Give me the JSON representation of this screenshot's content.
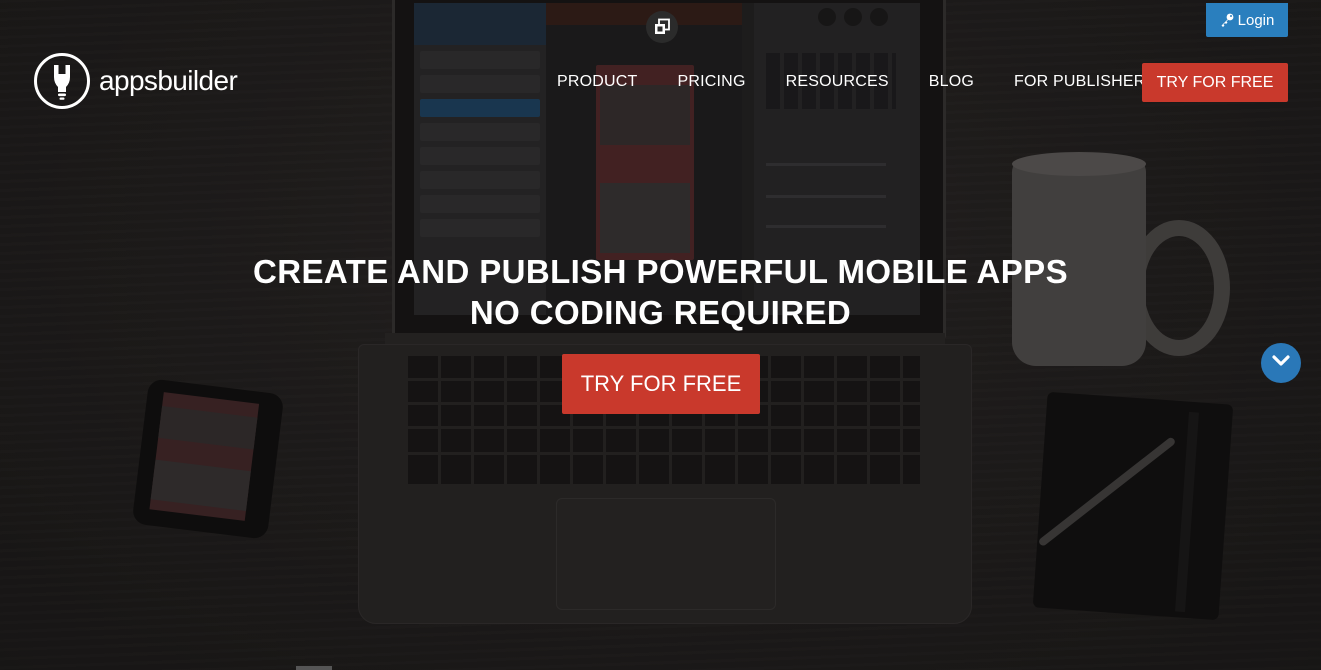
{
  "brand": {
    "name": "appsbuilder"
  },
  "header": {
    "login_label": "Login",
    "nav": [
      "PRODUCT",
      "PRICING",
      "RESOURCES",
      "BLOG",
      "FOR PUBLISHERS"
    ],
    "cta_label": "TRY FOR FREE"
  },
  "hero": {
    "title_line1": "CREATE AND PUBLISH POWERFUL MOBILE APPS",
    "title_line2": "NO CODING REQUIRED",
    "cta_label": "TRY FOR FREE"
  },
  "colors": {
    "accent_blue": "#2a7fbe",
    "cta_red": "#c9392c",
    "text": "#ffffff"
  },
  "icons": {
    "login": "key-icon",
    "scroll": "chevron-down-icon",
    "clone": "clone-icon",
    "logo": "lightbulb-wrench-icon"
  }
}
